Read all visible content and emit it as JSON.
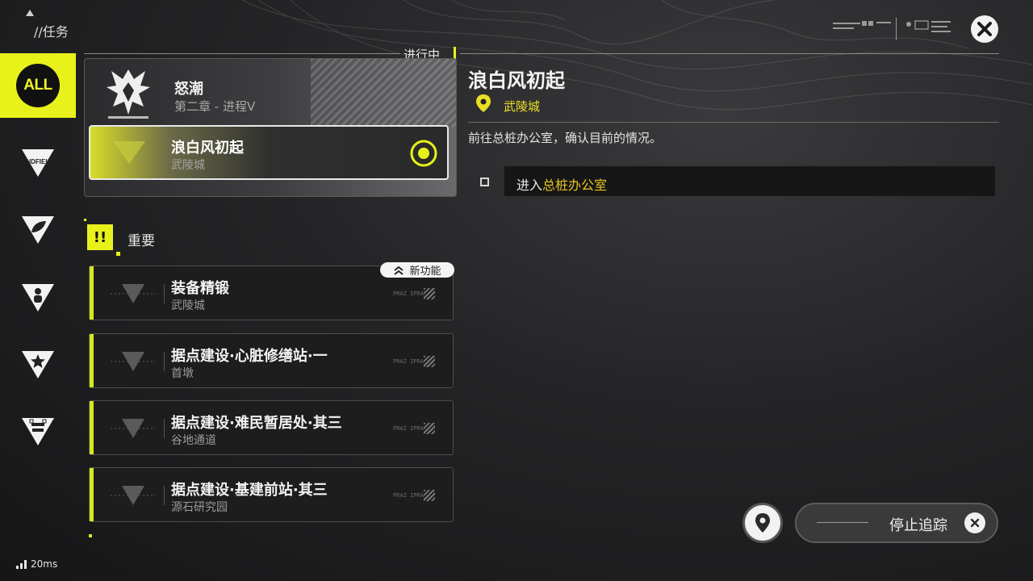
{
  "header": {
    "title": "//任务"
  },
  "rail": {
    "items": [
      {
        "label": "ALL",
        "icon": "all-icon",
        "active": true
      },
      {
        "label": "ENDFIELD",
        "icon": "endfield-icon"
      },
      {
        "label": "",
        "icon": "leaf-icon"
      },
      {
        "label": "",
        "icon": "person-icon"
      },
      {
        "label": "",
        "icon": "star-icon"
      },
      {
        "label": "",
        "icon": "base-icon"
      }
    ]
  },
  "in_progress": {
    "label": "进行中",
    "chapter": {
      "name": "怒潮",
      "subtitle": "第二章 - 进程V"
    },
    "current": {
      "name": "浪白风初起",
      "location": "武陵城"
    }
  },
  "important": {
    "label": "重要",
    "icon": "!!",
    "new_badge": "新功能",
    "quests": [
      {
        "name": "装备精锻",
        "location": "武陵城",
        "tag": "PRAZ IPRA"
      },
      {
        "name": "据点建设·心脏修缮站·一",
        "location": "首墩",
        "tag": "PRAZ IPRA"
      },
      {
        "name": "据点建设·难民暂居处·其三",
        "location": "谷地通道",
        "tag": "PRAZ IPRA"
      },
      {
        "name": "据点建设·基建前站·其三",
        "location": "源石研究园",
        "tag": "PRAZ IPRA"
      }
    ]
  },
  "detail": {
    "title": "浪白风初起",
    "location": "武陵城",
    "description": "前往总桩办公室，确认目前的情况。",
    "objective_prefix": "进入",
    "objective_highlight": "总桩办公室"
  },
  "footer": {
    "stop_tracking": "停止追踪",
    "ping": "20ms"
  },
  "colors": {
    "accent": "#e8f21a",
    "highlight": "#e8c420"
  }
}
